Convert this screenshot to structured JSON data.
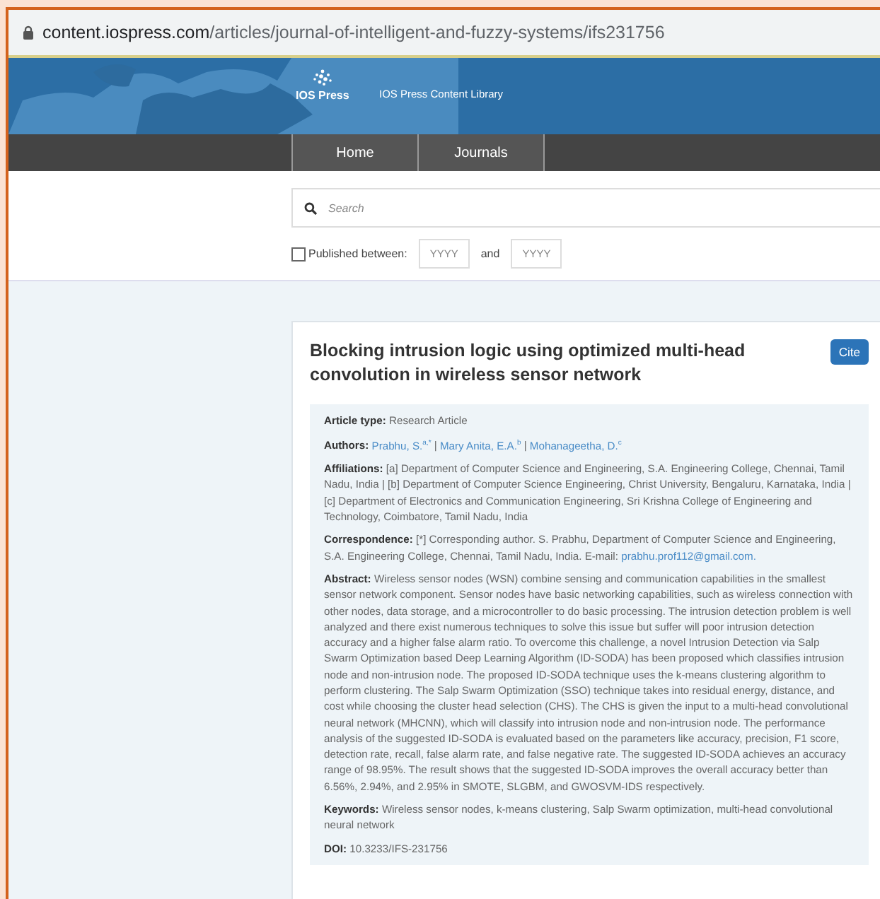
{
  "address_bar": {
    "host": "content.iospress.com",
    "path": "/articles/journal-of-intelligent-and-fuzzy-systems/ifs231756"
  },
  "banner": {
    "logo_text": "IOS Press",
    "title": "IOS Press Content Library"
  },
  "nav": [
    {
      "label": "Home",
      "selected": false
    },
    {
      "label": "Journals",
      "selected": false
    }
  ],
  "search": {
    "placeholder": "Search"
  },
  "date_filter": {
    "checked": false,
    "label": "Published between:",
    "from_placeholder": "YYYY",
    "joiner": "and",
    "to_placeholder": "YYYY"
  },
  "article": {
    "title": "Blocking intrusion logic using optimized multi-head convolution in wireless sensor network",
    "cite": "Cite",
    "details": [
      {
        "kind": "text",
        "label": "Article type:",
        "text": "Research Article"
      },
      {
        "kind": "authors",
        "label": "Authors:",
        "separator": "|",
        "authors": [
          "Prabhu, S.$^{a,*}$",
          "Mary Anita, E.A.$^{b}$",
          "Mohanageetha, D.$^{c}$"
        ]
      },
      {
        "kind": "text",
        "label": "Affiliations:",
        "text": "[a] Department of Computer Science and Engineering, S.A. Engineering College, Chennai, Tamil Nadu, India | [b] Department of Computer Science Engineering, Christ University, Bengaluru, Karnataka, India | [c] Department of Electronics and Communication Engineering, Sri Krishna College of Engineering and Technology, Coimbatore, Tamil Nadu, India"
      },
      {
        "kind": "email",
        "label": "Correspondence:",
        "text": "[*] Corresponding author. S. Prabhu, Department of Computer Science and Engineering, S.A. Engineering College, Chennai, Tamil Nadu, India. E-mail:",
        "email": "prabhu.prof112@gmail.com."
      },
      {
        "kind": "text",
        "label": "Abstract:",
        "text": "Wireless sensor nodes (WSN) combine sensing and communication capabilities in the smallest sensor network component. Sensor nodes have basic networking capabilities, such as wireless connection with other nodes, data storage, and a microcontroller to do basic processing. The intrusion detection problem is well analyzed and there exist numerous techniques to solve this issue but suffer will poor intrusion detection accuracy and a higher false alarm ratio. To overcome this challenge, a novel Intrusion Detection via Salp Swarm Optimization based Deep Learning Algorithm (ID-SODA) has been proposed which classifies intrusion node and non-intrusion node. The proposed ID-SODA technique uses the k-means clustering algorithm to perform clustering. The Salp Swarm Optimization (SSO) technique takes into residual energy, distance, and cost while choosing the cluster head selection (CHS). The CHS is given the input to a multi-head convolutional neural network (MHCNN), which will classify into intrusion node and non-intrusion node. The performance analysis of the suggested ID-SODA is evaluated based on the parameters like accuracy, precision, F1 score, detection rate, recall, false alarm rate, and false negative rate. The suggested ID-SODA achieves an accuracy range of 98.95%. The result shows that the suggested ID-SODA improves the overall accuracy better than 6.56%, 2.94%, and 2.95% in SMOTE, SLGBM, and GWOSVM-IDS respectively."
      },
      {
        "kind": "text",
        "label": "Keywords:",
        "text": "Wireless sensor nodes, k-means clustering, Salp Swarm optimization, multi-head convolutional neural network"
      },
      {
        "kind": "text",
        "label": "DOI:",
        "text": "10.3233/IFS-231756"
      }
    ]
  }
}
